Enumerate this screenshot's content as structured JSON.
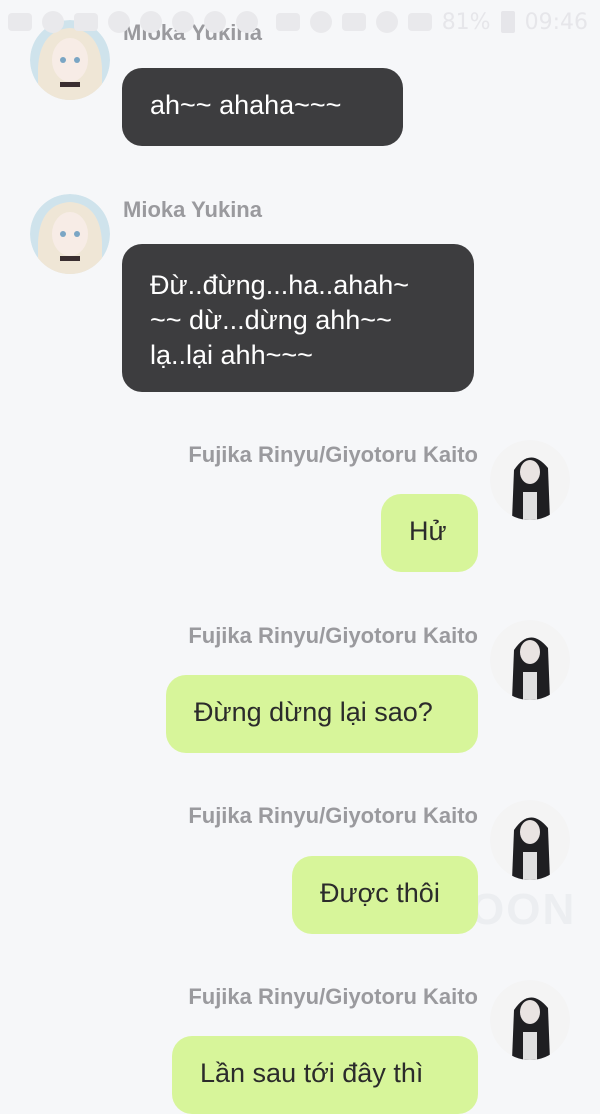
{
  "status_bar": {
    "battery_percent": "81%",
    "time": "09:46"
  },
  "messages": [
    {
      "side": "left",
      "sender": "Mioka Yukina",
      "text": "ah~~ ahaha~~~"
    },
    {
      "side": "left",
      "sender": "Mioka Yukina",
      "text_lines": [
        "Đừ..đừng...ha..ahah~",
        "~~ dừ...dừng ahh~~",
        "lạ..lại ahh~~~"
      ]
    },
    {
      "side": "right",
      "sender": "Fujika Rinyu/Giyotoru Kaito",
      "text": "Hử"
    },
    {
      "side": "right",
      "sender": "Fujika Rinyu/Giyotoru Kaito",
      "text": "Đừng dừng lại sao?"
    },
    {
      "side": "right",
      "sender": "Fujika Rinyu/Giyotoru Kaito",
      "text": "Được thôi"
    },
    {
      "side": "right",
      "sender": "Fujika Rinyu/Giyotoru Kaito",
      "text": "Lần sau tới đây thì"
    }
  ],
  "watermark": "OON",
  "colors": {
    "background": "#f6f7f9",
    "left_bubble": "#3d3d3f",
    "right_bubble": "#d7f59a",
    "sender_name": "#9a9a9e"
  },
  "icons": {
    "left_avatar": "anime-girl-avatar",
    "right_avatar": "dark-haired-character-avatar"
  }
}
